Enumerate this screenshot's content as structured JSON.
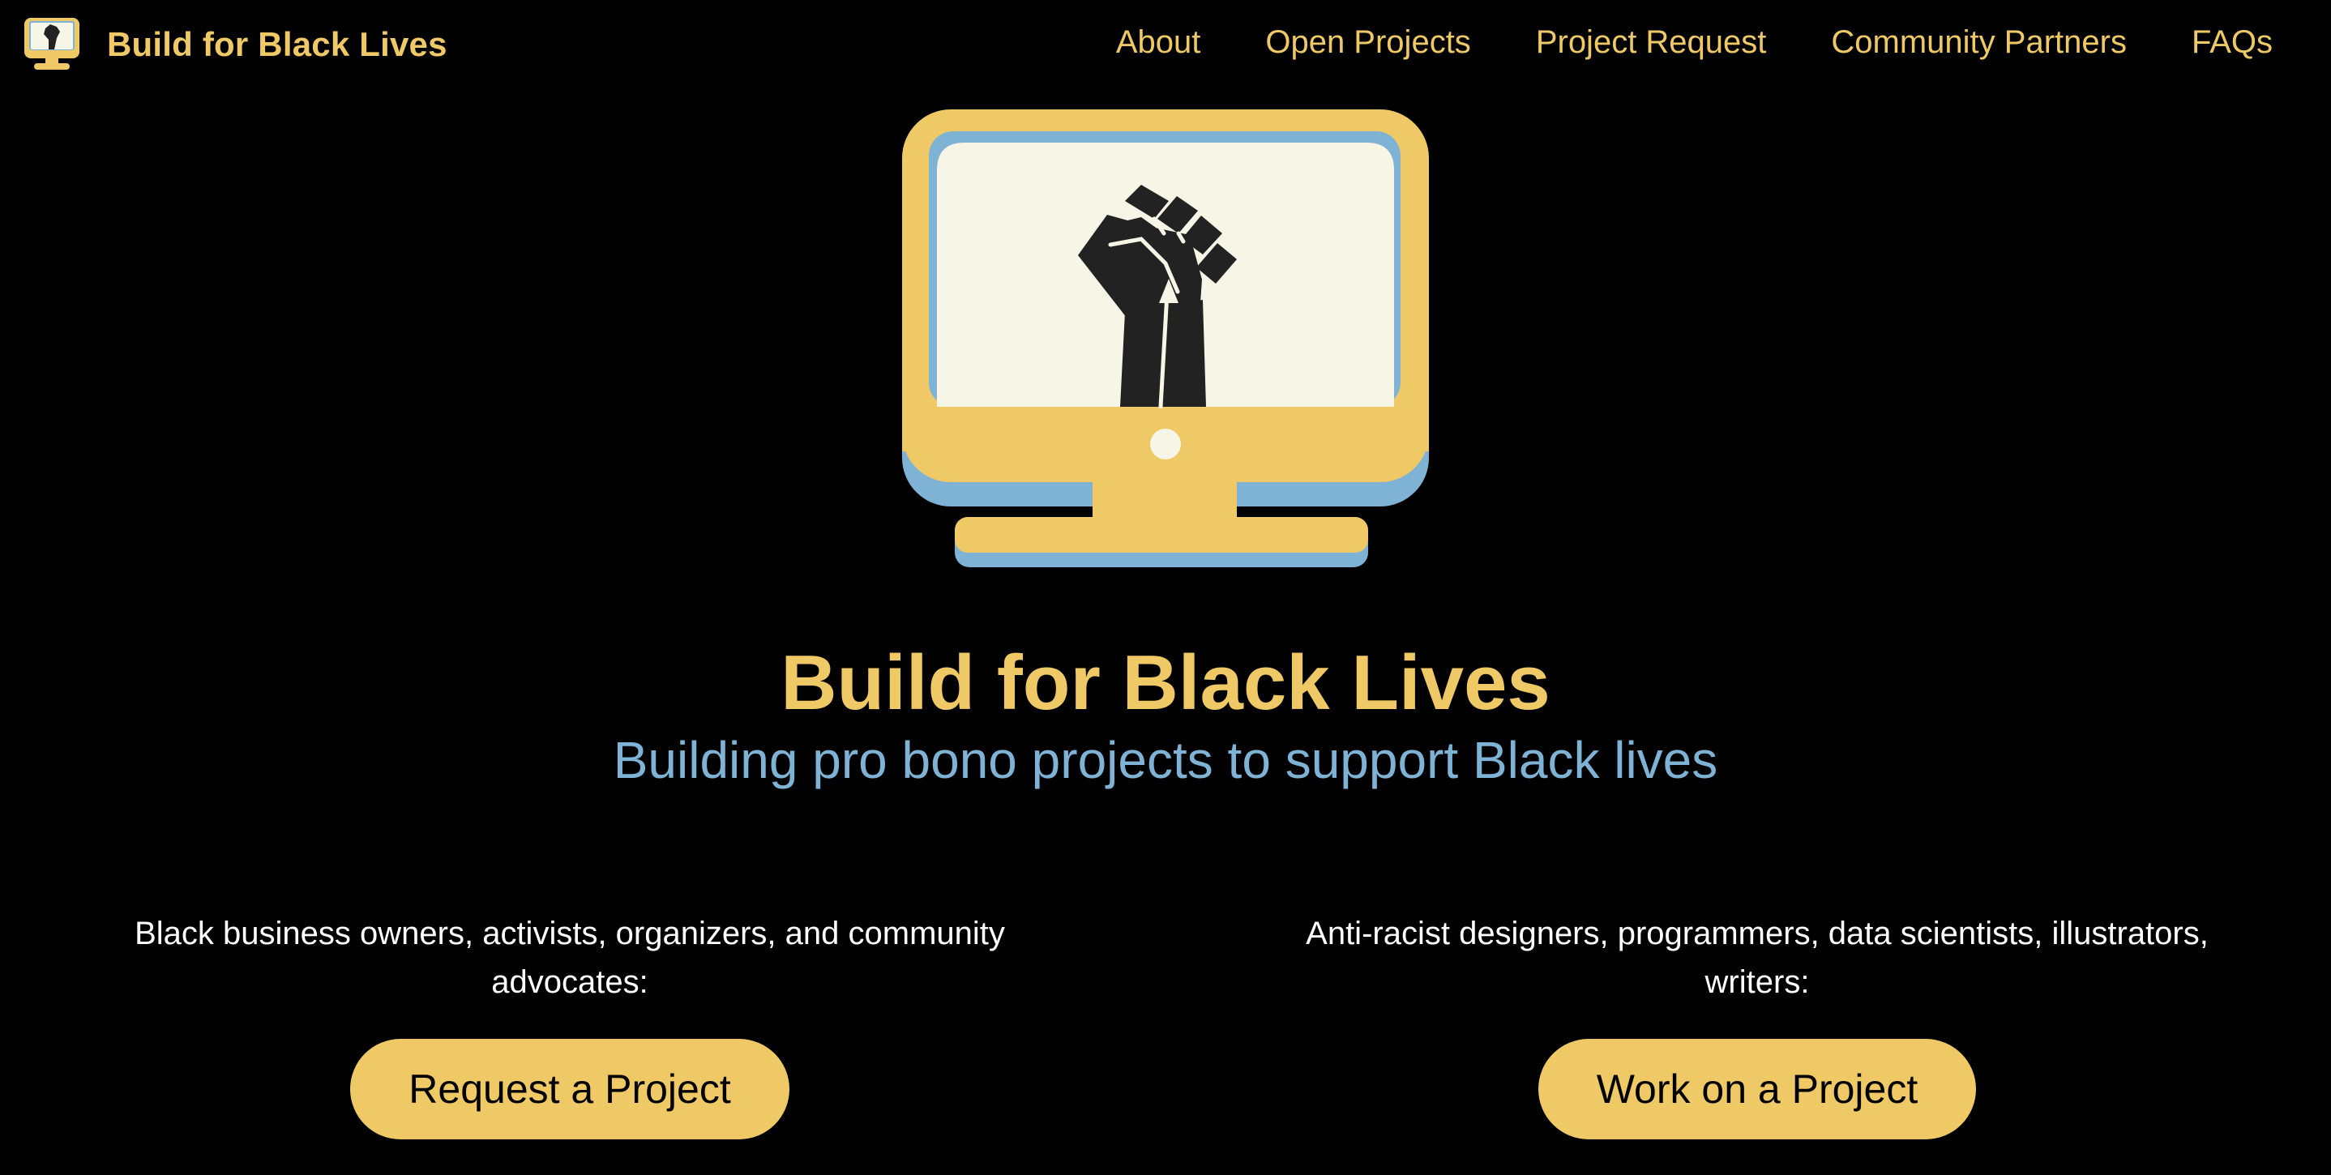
{
  "header": {
    "brand_name": "Build for Black Lives",
    "logo_icon": "monitor-fist-icon",
    "nav": [
      {
        "label": "About"
      },
      {
        "label": "Open Projects"
      },
      {
        "label": "Project Request"
      },
      {
        "label": "Community Partners"
      },
      {
        "label": "FAQs"
      }
    ]
  },
  "hero": {
    "illustration_icon": "monitor-raised-fist-icon",
    "title": "Build for Black Lives",
    "subtitle": "Building pro bono projects to support Black lives"
  },
  "cta": {
    "left": {
      "text": "Black business owners, activists, organizers, and community advocates:",
      "button_label": "Request a Project"
    },
    "right": {
      "text": "Anti-racist designers, programmers, data scientists, illustrators, writers:",
      "button_label": "Work on a Project"
    }
  },
  "colors": {
    "background": "#000000",
    "accent_yellow": "#efc965",
    "accent_blue": "#7fb3d5",
    "screen_cream": "#f7f5e6",
    "fist_dark": "#222222"
  }
}
